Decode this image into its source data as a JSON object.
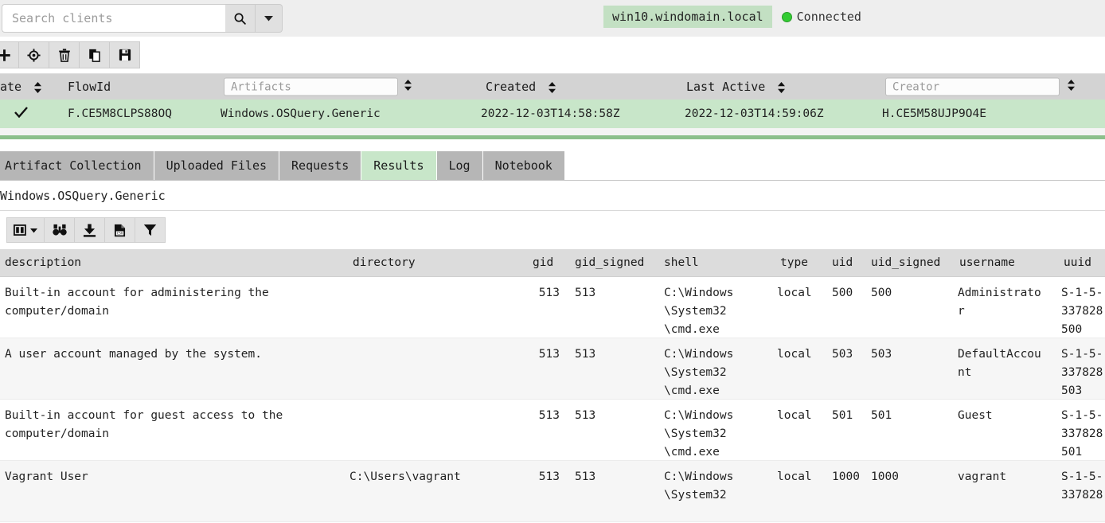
{
  "colors": {
    "selected_row": "#c8e6c9",
    "host_chip": "#c3e0c3",
    "status_green": "#33cc33",
    "divider_green": "#8cc08c",
    "header_grey": "#d3d3d3",
    "tab_grey": "#b6b6b6"
  },
  "topbar": {
    "search_placeholder": "Search clients",
    "search_value": "",
    "search_icon": "search-icon",
    "dropdown_icon": "caret-down-icon",
    "host": "win10.windomain.local",
    "status": "Connected"
  },
  "actionbar": {
    "buttons": [
      {
        "name": "new-collection-button",
        "icon": "plus-icon"
      },
      {
        "name": "locate-button",
        "icon": "crosshair-icon"
      },
      {
        "name": "delete-button",
        "icon": "trash-icon"
      },
      {
        "name": "copy-button",
        "icon": "copy-icon"
      },
      {
        "name": "save-button",
        "icon": "floppy-save-icon"
      }
    ]
  },
  "flow_table": {
    "headers": {
      "state": "ate",
      "flowid": "FlowId",
      "artifacts_placeholder": "Artifacts",
      "artifacts_value": "",
      "created": "Created",
      "last_active": "Last Active",
      "creator_placeholder": "Creator",
      "creator_value": ""
    },
    "row": {
      "state_icon": "checkmark-icon",
      "flowid": "F.CE5M8CLPS88OQ",
      "artifacts": "Windows.OSQuery.Generic",
      "created": "2022-12-03T14:58:58Z",
      "last_active": "2022-12-03T14:59:06Z",
      "creator": "H.CE5M58UJP9O4E"
    }
  },
  "tabs": [
    {
      "label": "Artifact Collection",
      "active": false
    },
    {
      "label": "Uploaded Files",
      "active": false
    },
    {
      "label": "Requests",
      "active": false
    },
    {
      "label": "Results",
      "active": true
    },
    {
      "label": "Log",
      "active": false
    },
    {
      "label": "Notebook",
      "active": false
    }
  ],
  "artifact_name": "Windows.OSQuery.Generic",
  "results_toolbar": {
    "buttons": [
      {
        "name": "column-chooser-button",
        "icon": "columns-dropdown-icon"
      },
      {
        "name": "search-rows-button",
        "icon": "binoculars-icon"
      },
      {
        "name": "download-button",
        "icon": "download-icon"
      },
      {
        "name": "export-csv-button",
        "icon": "csv-file-icon"
      },
      {
        "name": "filter-button",
        "icon": "funnel-icon"
      }
    ]
  },
  "results_table": {
    "columns": [
      "description",
      "directory",
      "gid",
      "gid_signed",
      "shell",
      "type",
      "uid",
      "uid_signed",
      "username",
      "uuid"
    ],
    "rows": [
      {
        "description": "Built-in account for administering the computer/domain",
        "directory": "",
        "gid": "513",
        "gid_signed": "513",
        "shell": "C:\\Windows\n\\System32\n\\cmd.exe",
        "type": "local",
        "uid": "500",
        "uid_signed": "500",
        "username": "Administrato\nr",
        "uuid": "S-1-5-\n337828\n500"
      },
      {
        "description": "A user account managed by the system.",
        "directory": "",
        "gid": "513",
        "gid_signed": "513",
        "shell": "C:\\Windows\n\\System32\n\\cmd.exe",
        "type": "local",
        "uid": "503",
        "uid_signed": "503",
        "username": "DefaultAccou\nnt",
        "uuid": "S-1-5-\n337828\n503"
      },
      {
        "description": "Built-in account for guest access to the computer/domain",
        "directory": "",
        "gid": "513",
        "gid_signed": "513",
        "shell": "C:\\Windows\n\\System32\n\\cmd.exe",
        "type": "local",
        "uid": "501",
        "uid_signed": "501",
        "username": "Guest",
        "uuid": "S-1-5-\n337828\n501"
      },
      {
        "description": "Vagrant User",
        "directory": "C:\\Users\\vagrant",
        "gid": "513",
        "gid_signed": "513",
        "shell": "C:\\Windows\n\\System32",
        "type": "local",
        "uid": "1000",
        "uid_signed": "1000",
        "username": "vagrant",
        "uuid": "S-1-5-\n337828"
      }
    ]
  }
}
